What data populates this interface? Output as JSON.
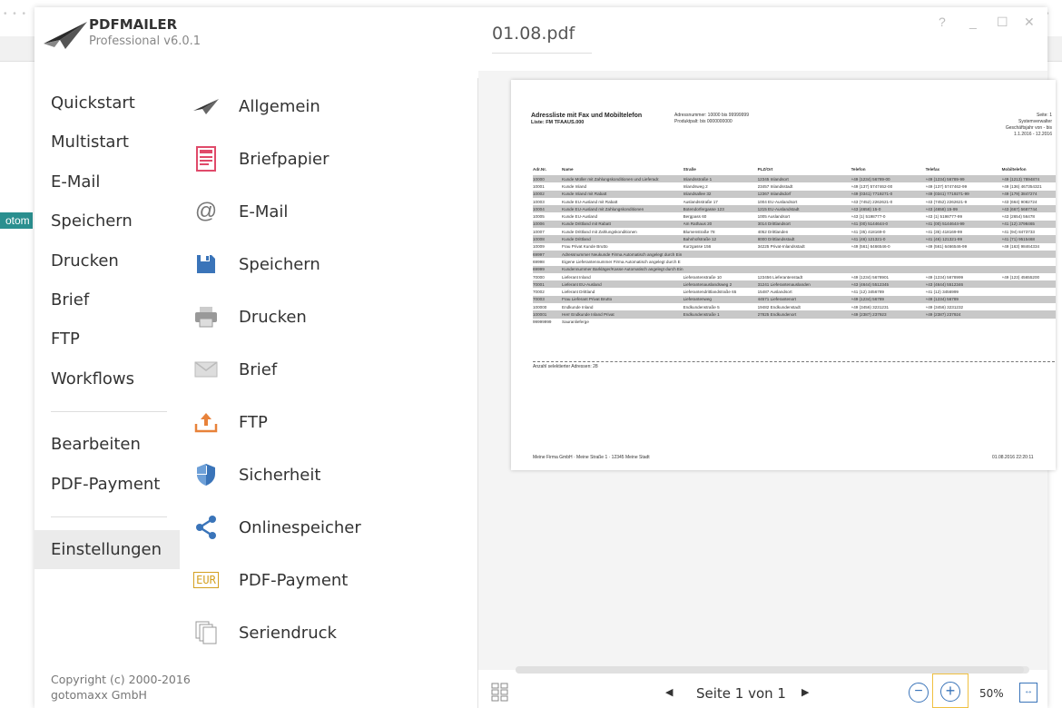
{
  "app": {
    "name": "PDFMAILER",
    "version": "Professional v6.0.1",
    "document_title": "01.08.pdf",
    "background_tag": "otom"
  },
  "window_controls": {
    "help": "?",
    "minimize": "_",
    "maximize": "☐",
    "close": "✕"
  },
  "nav_primary": [
    {
      "label": "Quickstart"
    },
    {
      "label": "Multistart"
    },
    {
      "label": "E-Mail"
    },
    {
      "label": "Speichern"
    },
    {
      "label": "Drucken"
    },
    {
      "label": "Brief"
    },
    {
      "label": "FTP"
    },
    {
      "label": "Workflows"
    }
  ],
  "nav_primary_b": [
    {
      "label": "Bearbeiten"
    },
    {
      "label": "PDF-Payment"
    }
  ],
  "nav_primary_c": {
    "label": "Einstellungen"
  },
  "nav_settings": [
    {
      "label": "Allgemein",
      "icon": "paper-plane-icon"
    },
    {
      "label": "Briefpapier",
      "icon": "letterhead-icon"
    },
    {
      "label": "E-Mail",
      "icon": "at-sign-icon"
    },
    {
      "label": "Speichern",
      "icon": "floppy-disk-icon"
    },
    {
      "label": "Drucken",
      "icon": "printer-icon"
    },
    {
      "label": "Brief",
      "icon": "envelope-icon"
    },
    {
      "label": "FTP",
      "icon": "upload-icon"
    },
    {
      "label": "Sicherheit",
      "icon": "shield-icon"
    },
    {
      "label": "Onlinespeicher",
      "icon": "share-icon"
    },
    {
      "label": "PDF-Payment",
      "icon": "eur-icon",
      "icon_text": "EUR"
    },
    {
      "label": "Seriendruck",
      "icon": "copies-icon"
    }
  ],
  "copyright": {
    "line1": "Copyright (c) 2000-2016",
    "line2": "gotomaxx GmbH"
  },
  "colors": {
    "accent_blue": "#3a74b9",
    "accent_orange": "#e8823a",
    "accent_pink": "#e04a6a",
    "zoom_highlight": "#f0c040"
  },
  "preview": {
    "title": "Adressliste mit Fax und Mobiltelefon",
    "subtitle": "Liste: FM TFAAUS.000",
    "meta_left": [
      "Adressnummer:   10000 bis 99999999",
      "Produktpalt:        bis 0000000000"
    ],
    "meta_right": [
      "Seite:   1",
      "Systemverwalter",
      "Geschäftsjahr von - bis",
      "1.1.2016 - 12.2016"
    ],
    "columns": [
      "Adr.Nr.",
      "Name",
      "Straße",
      "PLZ/Ort",
      "Telefon",
      "Telefax",
      "Mobiltelefon"
    ],
    "rows": [
      {
        "g": true,
        "c": [
          "10000",
          "Kunde Müller mit Zahlungskonditionen und Lieferadr.",
          "Inlandsstraße 1",
          "12345 Inlandsort",
          "+49 (1234) 56789-00",
          "+49 (1234) 56789-99",
          "+49 (1213) 7894874"
        ]
      },
      {
        "g": false,
        "c": [
          "10001",
          "Kunde Inland",
          "Inlandsweg 2",
          "23457 Inlandsstadt",
          "+49 (137) 5747462-00",
          "+49 (137) 5747462-99",
          "+49 (136) 467354321"
        ]
      },
      {
        "g": true,
        "c": [
          "10002",
          "Kunde Inland mit Rabatt",
          "Inlandsallee 32",
          "12367 Inlandsdorf",
          "+49 (0341) 7719271-0",
          "+49 (0341) 7719271-99",
          "+49 (179) 3847274"
        ]
      },
      {
        "g": false,
        "c": [
          "10003",
          "Kunde EU-Ausland mit Rabatt",
          "Auslandsstraße 17",
          "1004 EU-Auslandsort",
          "+43 (7452) 2262621-0",
          "+43 (7452) 2262621-9",
          "+43 (664) 9082724"
        ]
      },
      {
        "g": true,
        "c": [
          "10004",
          "Kunde EU-Ausland mit Zahlungskonditionen",
          "Botendorfergasse 123",
          "1215 EU-Auslandstadt",
          "+43 (4658) 15-0",
          "+43 (4658) 15-99",
          "+43 (667) 5687744"
        ]
      },
      {
        "g": false,
        "c": [
          "10005",
          "Kunde EU-Ausland",
          "Bergpass 60",
          "1005 Auslandsort",
          "+43 (1) 5198777-0",
          "+43 (1) 5198777-99",
          "+43 (2654) 56478"
        ]
      },
      {
        "g": true,
        "c": [
          "10006",
          "Kunde Drittland mit Rabatt",
          "Am Rathaus 20",
          "3014 Drittlandsort",
          "+41 (00) 5144644-0",
          "+41 (00) 5144644-99",
          "+41 (12) 3798465"
        ]
      },
      {
        "g": false,
        "c": [
          "10007",
          "Kunde Drittland mit Zahlungskonditionen",
          "Blumenstraße 78",
          "4052 Drittlanden",
          "+41 (35) 418169-0",
          "+41 (35) 418169-99",
          "+41 (94) 8473733"
        ]
      },
      {
        "g": true,
        "c": [
          "10008",
          "Kunde Drittland",
          "Bahnhofstraße 12",
          "8000 Drittlandsstadt",
          "+41 (46) 121321-0",
          "+41 (46) 121321-99",
          "+41 (71) 9515468"
        ]
      },
      {
        "g": false,
        "c": [
          "10009",
          "Frau Privat Kunde Brutto",
          "Kurzgasse 156",
          "34225 Privat-Inlandsstadt",
          "+49 (561) 6466546-0",
          "+49 (561) 6466546-99",
          "+49 (163) 98464334"
        ]
      },
      {
        "g": true,
        "c": [
          "69997",
          "Adressnummer Neukunde Firma Automatisch angelegt durch Ein",
          "",
          "",
          "",
          "",
          ""
        ]
      },
      {
        "g": false,
        "c": [
          "69998",
          "Eigene Lieferantennummer Firma Automatisch angelegt durch E",
          "",
          "",
          "",
          "",
          ""
        ]
      },
      {
        "g": true,
        "c": [
          "69999",
          "Kundennummer Barkläger/Kasse Automatisch angelegt durch Ein",
          "",
          "",
          "",
          "",
          ""
        ]
      },
      {
        "g": false,
        "c": [
          "70000",
          "Lieferant Inland",
          "Lieferantenstraße 10",
          "123456 Lieferantenstadt",
          "+49 (1234) 5678901",
          "+49 (1234) 5678999",
          "+49 (123) 45655200"
        ]
      },
      {
        "g": true,
        "c": [
          "70001",
          "Lieferant EU-Ausland",
          "Lieferantenauslandsweg 2",
          "31241 Lieferantenauslanden",
          "+43 (4644) 5512345",
          "+43 (4644) 5512346",
          ""
        ]
      },
      {
        "g": false,
        "c": [
          "70002",
          "Lieferant Drittland",
          "Lieferantendrittlandstraße 65",
          "15487 Auslandsort",
          "+41 (12) 3456789",
          "+41 (12) 3456999",
          ""
        ]
      },
      {
        "g": true,
        "c": [
          "70003",
          "Frau Lieferant Privat Brutto",
          "Lieferantenweg",
          "44571 Lieferantenort",
          "+49 (1234) 56789",
          "+49 (1234) 56789",
          ""
        ]
      },
      {
        "g": false,
        "c": [
          "100000",
          "Endkunde Inland",
          "Endkundenstraße 5",
          "19482 Endkundenstadt",
          "+49 (3456) 3231231",
          "+49 (3456) 3231232",
          ""
        ]
      },
      {
        "g": true,
        "c": [
          "100001",
          "Herr Endkunde Inland Privat",
          "Endkundenstraße 1",
          "27825 Endkundenort",
          "+49 (2387) 237923",
          "+49 (2387) 237924",
          ""
        ]
      },
      {
        "g": false,
        "c": [
          "99999999",
          "Sauranlieferge",
          "",
          "",
          "",
          "",
          ""
        ]
      }
    ],
    "count_text": "Anzahl selektierter Adressen:    28",
    "footer_left": "Meine Firma GmbH  ·  Meine Straße 1  ·  12345 Meine Stadt",
    "footer_right": "01.08.2016 22:20:11"
  },
  "bottombar": {
    "page_label": "Seite 1 von 1",
    "prev": "◀",
    "next": "▶",
    "zoom_out": "−",
    "zoom_in": "+",
    "zoom_value": "50%",
    "fit": "↔"
  }
}
